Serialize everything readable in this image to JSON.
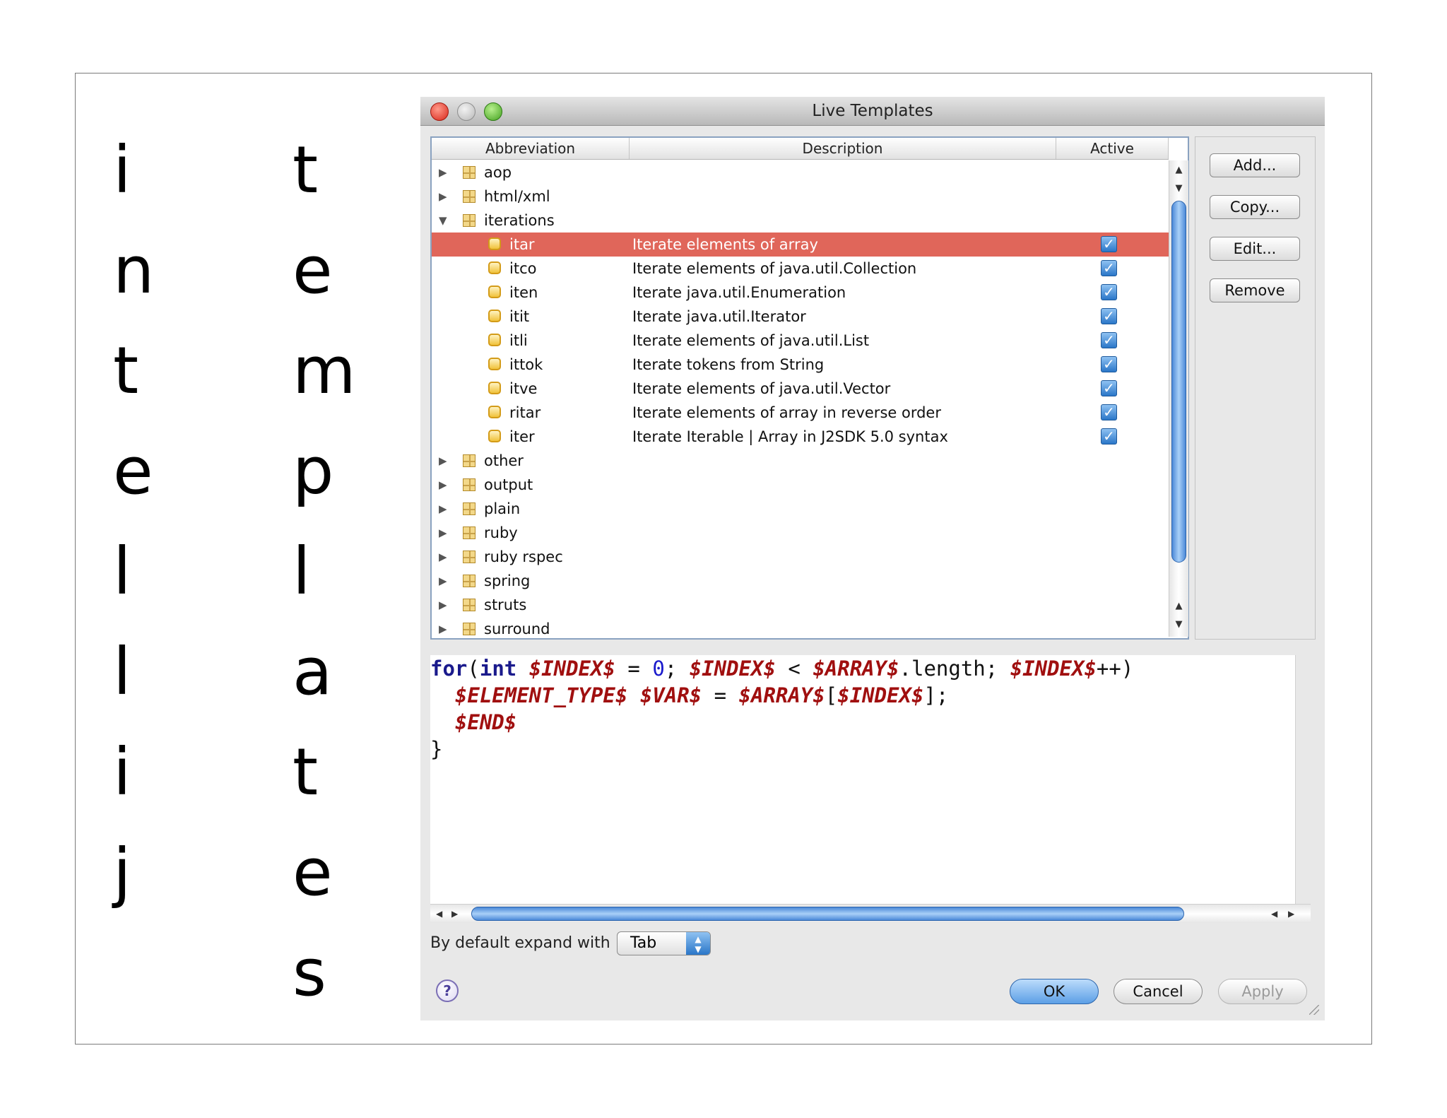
{
  "slide": {
    "left_letters": [
      "i",
      "n",
      "t",
      "e",
      "l",
      "l",
      "i",
      "j"
    ],
    "right_letters": [
      "t",
      "e",
      "m",
      "p",
      "l",
      "a",
      "t",
      "e",
      "s"
    ]
  },
  "window": {
    "title": "Live Templates"
  },
  "table": {
    "columns": [
      "Abbreviation",
      "Description",
      "Active"
    ],
    "groups_before": [
      {
        "name": "aop",
        "expanded": false
      },
      {
        "name": "html/xml",
        "expanded": false
      },
      {
        "name": "iterations",
        "expanded": true
      }
    ],
    "templates": [
      {
        "abbr": "itar",
        "desc": "Iterate elements of array",
        "active": true,
        "selected": true
      },
      {
        "abbr": "itco",
        "desc": "Iterate elements of java.util.Collection",
        "active": true
      },
      {
        "abbr": "iten",
        "desc": "Iterate java.util.Enumeration",
        "active": true
      },
      {
        "abbr": "itit",
        "desc": "Iterate java.util.Iterator",
        "active": true
      },
      {
        "abbr": "itli",
        "desc": "Iterate elements of java.util.List",
        "active": true
      },
      {
        "abbr": "ittok",
        "desc": "Iterate tokens from String",
        "active": true
      },
      {
        "abbr": "itve",
        "desc": "Iterate elements of java.util.Vector",
        "active": true
      },
      {
        "abbr": "ritar",
        "desc": "Iterate elements of array in reverse order",
        "active": true
      },
      {
        "abbr": "iter",
        "desc": "Iterate Iterable | Array in J2SDK 5.0 syntax",
        "active": true
      }
    ],
    "groups_after": [
      {
        "name": "other"
      },
      {
        "name": "output"
      },
      {
        "name": "plain"
      },
      {
        "name": "ruby"
      },
      {
        "name": "ruby rspec"
      },
      {
        "name": "spring"
      },
      {
        "name": "struts"
      },
      {
        "name": "surround"
      }
    ]
  },
  "side_buttons": {
    "add": "Add...",
    "copy": "Copy...",
    "edit": "Edit...",
    "remove": "Remove"
  },
  "editor": {
    "line1": {
      "kw_for": "for",
      "paren_open": "(",
      "kw_int": "int",
      "sp": " ",
      "v1": "$INDEX$",
      "eq0": " = ",
      "zero": "0",
      "semi1": "; ",
      "v2": "$INDEX$",
      "lt": " < ",
      "v3": "$ARRAY$",
      "len": ".length; ",
      "v4": "$INDEX$",
      "tail": "++)"
    },
    "line2": {
      "indent": "  ",
      "v1": "$ELEMENT_TYPE$",
      "sp": " ",
      "v2": "$VAR$",
      "eq": " = ",
      "v3": "$ARRAY$",
      "br": "[",
      "v4": "$INDEX$",
      "end": "];"
    },
    "line3": {
      "indent": "  ",
      "v1": "$END$"
    },
    "line4": "}"
  },
  "expand": {
    "label": "By default expand with",
    "selected": "Tab"
  },
  "dialog_buttons": {
    "help": "?",
    "ok": "OK",
    "cancel": "Cancel",
    "apply": "Apply"
  },
  "colors": {
    "selection": "#e0665a",
    "scroll_thumb": "#4b89d8",
    "code_variable": "#a00f0f",
    "code_keyword": "#1a1a8c"
  }
}
